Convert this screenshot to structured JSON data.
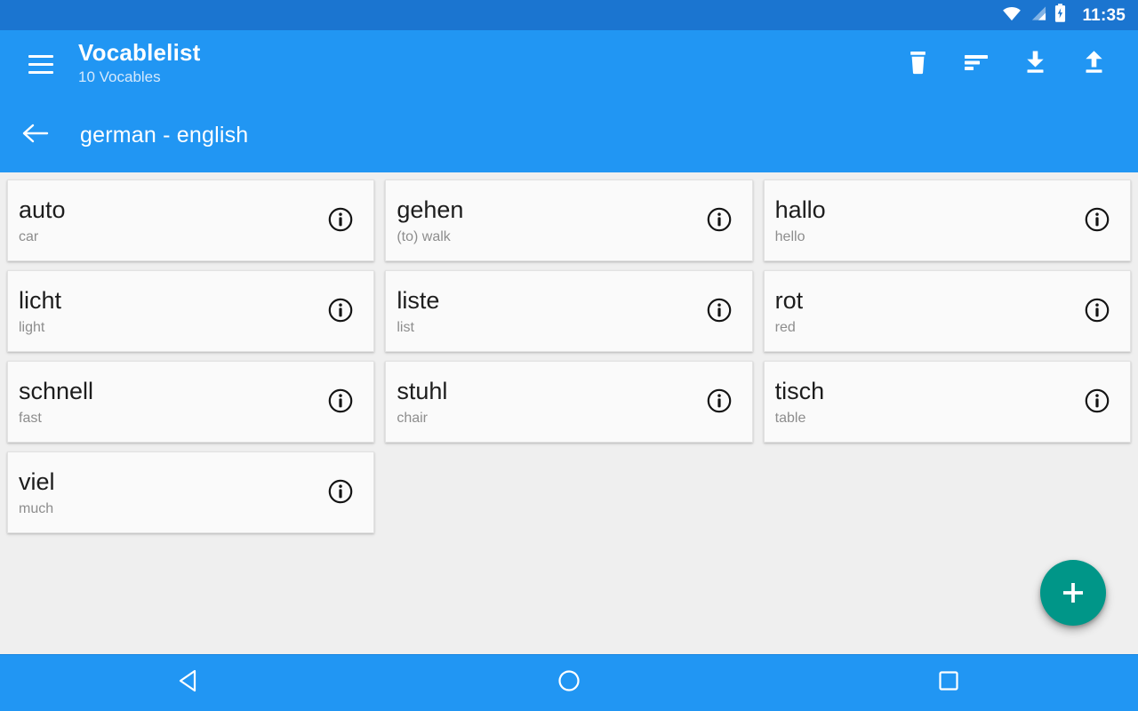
{
  "status_bar": {
    "time": "11:35",
    "icons": [
      "wifi-icon",
      "cellular-signal-icon",
      "battery-charging-icon"
    ]
  },
  "app_bar": {
    "menu_icon": "hamburger-menu-icon",
    "title": "Vocablelist",
    "subtitle": "10 Vocables",
    "actions": [
      {
        "name": "delete-button",
        "icon": "trash-icon",
        "label": "Delete"
      },
      {
        "name": "sort-button",
        "icon": "sort-icon",
        "label": "Sort"
      },
      {
        "name": "import-button",
        "icon": "download-icon",
        "label": "Import"
      },
      {
        "name": "export-button",
        "icon": "upload-icon",
        "label": "Export"
      }
    ],
    "back_icon": "arrow-left-icon",
    "list_name": "german - english"
  },
  "colors": {
    "status_bar": "#1b75d0",
    "app_bar": "#2196f3",
    "background": "#efefef",
    "card": "#fafafa",
    "fab": "#009688",
    "word_text": "#1d1d1d",
    "translation_text": "#8d8d8d"
  },
  "vocables": [
    {
      "word": "auto",
      "translation": "car"
    },
    {
      "word": "gehen",
      "translation": "(to) walk"
    },
    {
      "word": "hallo",
      "translation": "hello"
    },
    {
      "word": "licht",
      "translation": "light"
    },
    {
      "word": "liste",
      "translation": "list"
    },
    {
      "word": "rot",
      "translation": "red"
    },
    {
      "word": "schnell",
      "translation": "fast"
    },
    {
      "word": "stuhl",
      "translation": "chair"
    },
    {
      "word": "tisch",
      "translation": "table"
    },
    {
      "word": "viel",
      "translation": "much"
    }
  ],
  "fab": {
    "icon": "plus-icon",
    "label": "Add vocable"
  },
  "nav_bar": {
    "buttons": [
      {
        "name": "nav-back-button",
        "icon": "triangle-back-icon"
      },
      {
        "name": "nav-home-button",
        "icon": "circle-home-icon"
      },
      {
        "name": "nav-recents-button",
        "icon": "square-recents-icon"
      }
    ]
  }
}
